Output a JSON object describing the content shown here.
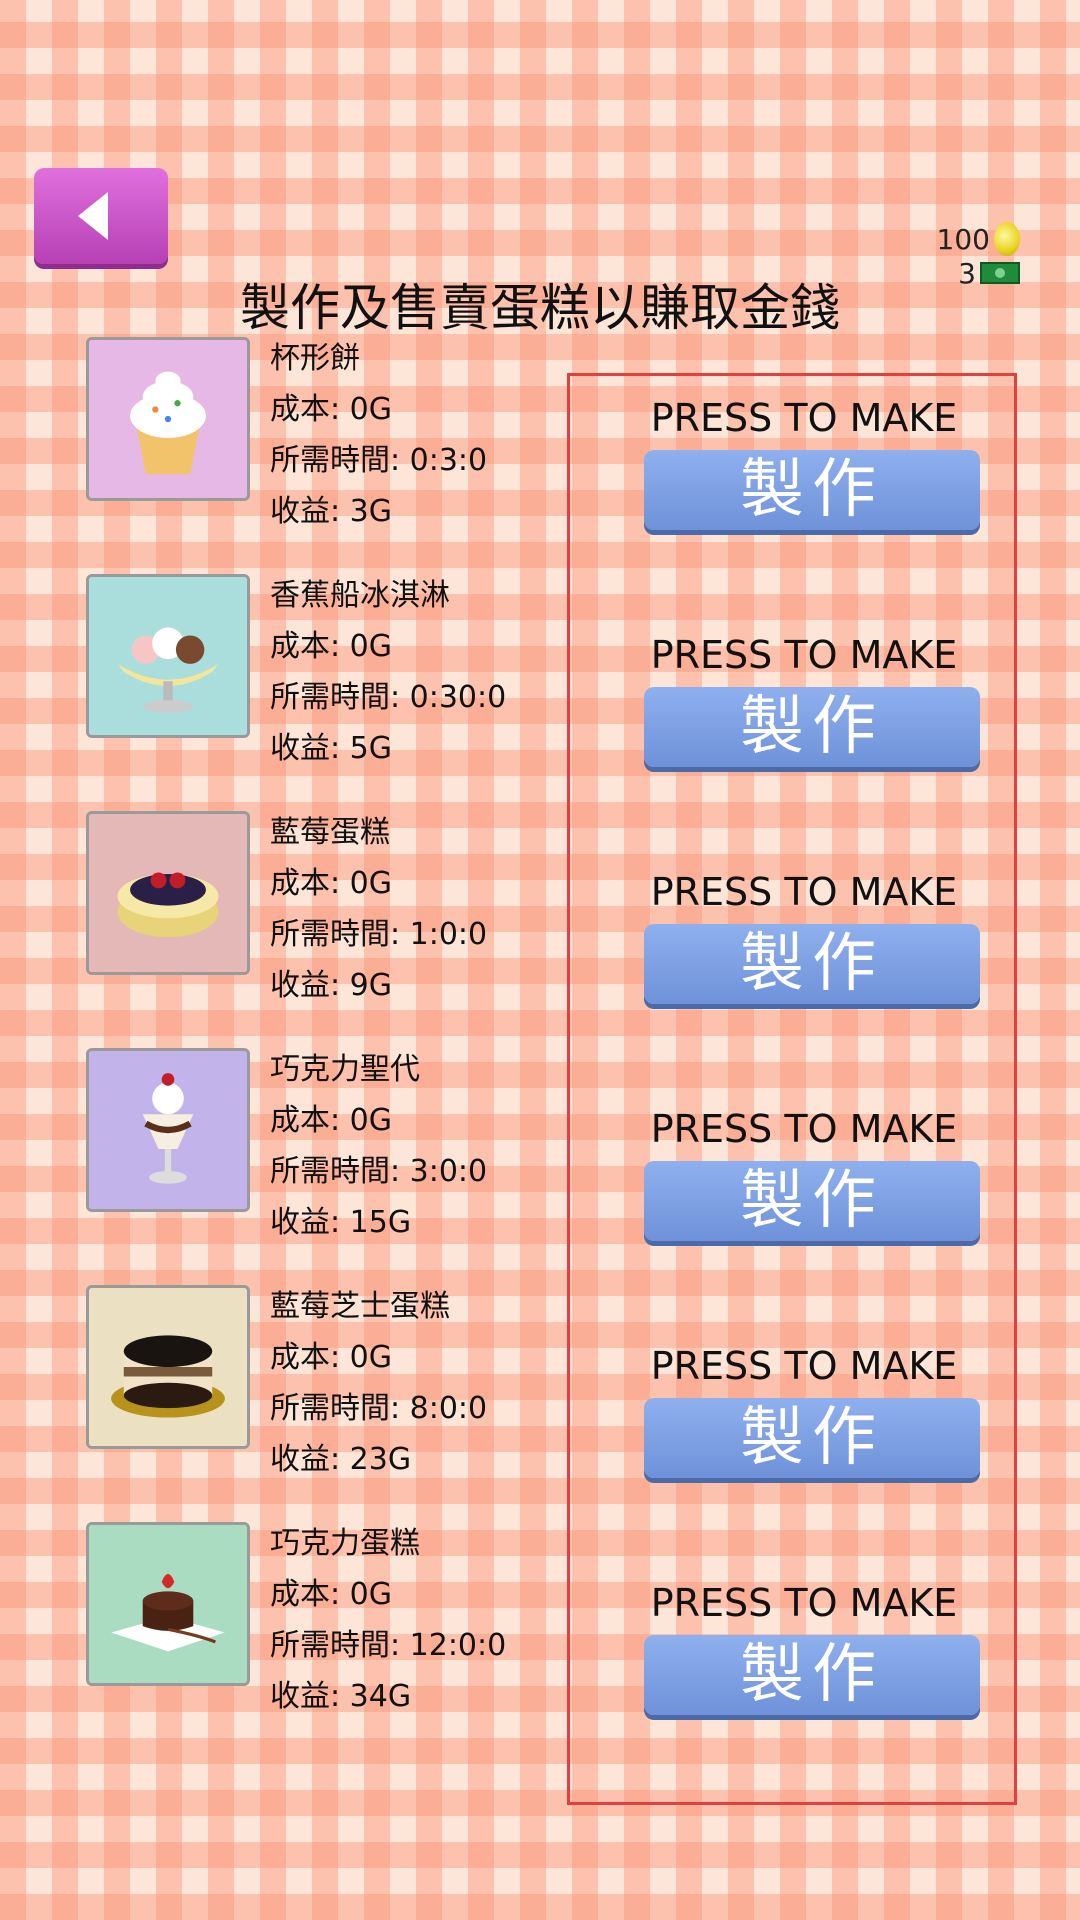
{
  "title": "製作及售賣蛋糕以賺取金錢",
  "currency": {
    "coins": "100",
    "cash": "3"
  },
  "items": [
    {
      "name": "杯形餅",
      "cost": "成本: 0G",
      "time": "所需時間: 0:3:0",
      "profit": "收益: 3G",
      "bg": "#e6b8e6",
      "icon": "cupcake-icon"
    },
    {
      "name": "香蕉船冰淇淋",
      "cost": "成本: 0G",
      "time": "所需時間: 0:30:0",
      "profit": "收益: 5G",
      "bg": "#a9dedd",
      "icon": "banana-split-icon"
    },
    {
      "name": "藍莓蛋糕",
      "cost": "成本: 0G",
      "time": "所需時間: 1:0:0",
      "profit": "收益: 9G",
      "bg": "#e4b8b6",
      "icon": "blueberry-cake-icon"
    },
    {
      "name": "巧克力聖代",
      "cost": "成本: 0G",
      "time": "所需時間: 3:0:0",
      "profit": "收益: 15G",
      "bg": "#c2b4ea",
      "icon": "chocolate-sundae-icon"
    },
    {
      "name": "藍莓芝士蛋糕",
      "cost": "成本: 0G",
      "time": "所需時間: 8:0:0",
      "profit": "收益: 23G",
      "bg": "#ece0c2",
      "icon": "blueberry-cheesecake-icon"
    },
    {
      "name": "巧克力蛋糕",
      "cost": "成本: 0G",
      "time": "所需時間: 12:0:0",
      "profit": "收益: 34G",
      "bg": "#a9dcc0",
      "icon": "chocolate-cake-icon"
    }
  ],
  "make": {
    "prompt": "PRESS TO MAKE",
    "button_label": "製作"
  },
  "colors": {
    "back_button": "#c84fc6",
    "make_button": "#7b9ee3",
    "panel_border": "#e04040"
  }
}
